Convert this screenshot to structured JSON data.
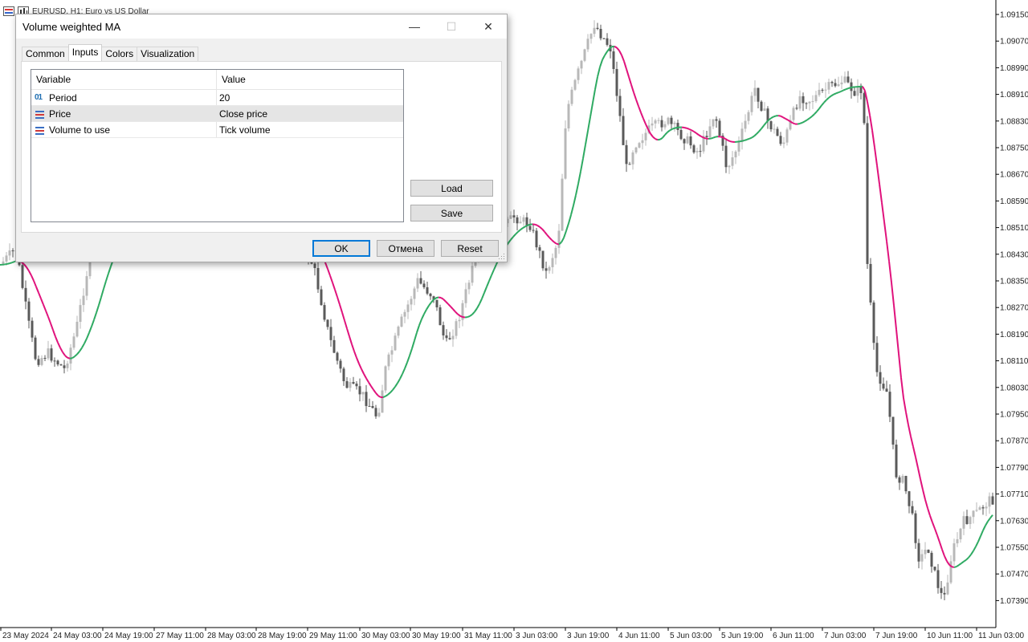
{
  "chart": {
    "window_title": "EURUSD, H1:  Euro vs US Dollar",
    "price_labels": [
      "1.09150",
      "1.09070",
      "1.08990",
      "1.08910",
      "1.08830",
      "1.08750",
      "1.08670",
      "1.08590",
      "1.08510",
      "1.08430",
      "1.08350",
      "1.08270",
      "1.08190",
      "1.08110",
      "1.08030",
      "1.07950",
      "1.07870",
      "1.07790",
      "1.07710",
      "1.07630",
      "1.07550",
      "1.07470",
      "1.07390"
    ],
    "time_labels": [
      "23 May 2024",
      "24 May 03:00",
      "24 May 19:00",
      "27 May 11:00",
      "28 May 03:00",
      "28 May 19:00",
      "29 May 11:00",
      "30 May 03:00",
      "30 May 19:00",
      "31 May 11:00",
      "3 Jun 03:00",
      "3 Jun 19:00",
      "4 Jun 11:00",
      "5 Jun 03:00",
      "5 Jun 19:00",
      "6 Jun 11:00",
      "7 Jun 03:00",
      "7 Jun 19:00",
      "10 Jun 11:00",
      "11 Jun 03:00"
    ],
    "colors": {
      "ma_up": "#2eaa62",
      "ma_down": "#e0127c",
      "candle_dark": "#5a5a5a",
      "candle_light": "#b8b8b8"
    }
  },
  "dialog": {
    "title": "Volume weighted MA",
    "minimize": "—",
    "maximize": "☐",
    "close": "✕",
    "tabs": [
      {
        "label": "Common"
      },
      {
        "label": "Inputs"
      },
      {
        "label": "Colors"
      },
      {
        "label": "Visualization"
      }
    ],
    "grid": {
      "header_variable": "Variable",
      "header_value": "Value",
      "rows": [
        {
          "icon": "01",
          "variable": "Period",
          "value": "20"
        },
        {
          "icon": "enum-icon",
          "variable": "Price",
          "value": "Close price"
        },
        {
          "icon": "enum-icon",
          "variable": "Volume to use",
          "value": "Tick volume"
        }
      ]
    },
    "load_label": "Load",
    "save_label": "Save",
    "ok_label": "OK",
    "cancel_label": "Отмена",
    "reset_label": "Reset"
  }
}
